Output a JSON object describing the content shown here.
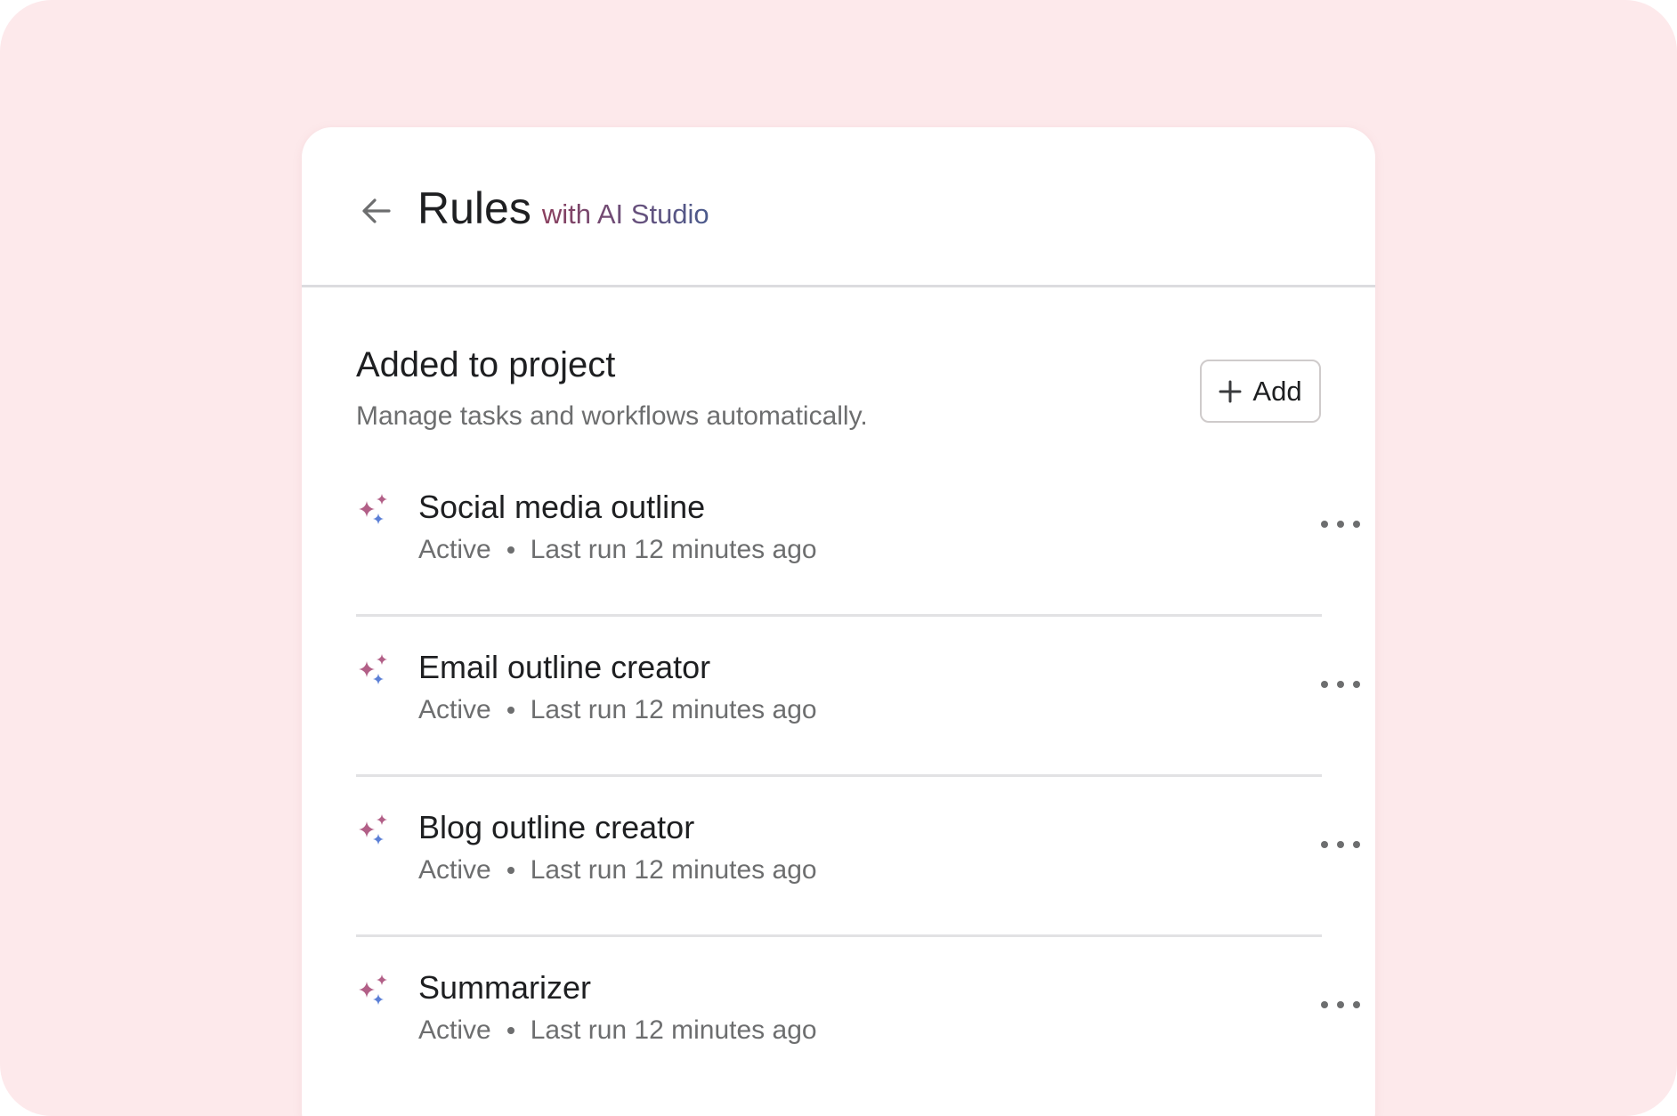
{
  "header": {
    "title": "Rules",
    "subtitle": "with AI Studio"
  },
  "section": {
    "title": "Added to project",
    "description": "Manage tasks and workflows automatically.",
    "add_label": "Add"
  },
  "rules": [
    {
      "name": "Social media outline",
      "status": "Active",
      "last_run": "Last run 12 minutes ago"
    },
    {
      "name": "Email outline creator",
      "status": "Active",
      "last_run": "Last run 12 minutes ago"
    },
    {
      "name": "Blog outline creator",
      "status": "Active",
      "last_run": "Last run 12 minutes ago"
    },
    {
      "name": "Summarizer",
      "status": "Active",
      "last_run": "Last run 12 minutes ago"
    }
  ],
  "icons": {
    "back": "arrow-left-icon",
    "add": "plus-icon",
    "rule": "sparkle-icon",
    "more": "more-horizontal-icon"
  },
  "colors": {
    "background": "#fde9eb",
    "card": "#ffffff",
    "text_primary": "#1e1f21",
    "text_secondary": "#6d6e6f",
    "sparkle_pink": "#b25f87",
    "sparkle_blue": "#5b7fd6"
  }
}
